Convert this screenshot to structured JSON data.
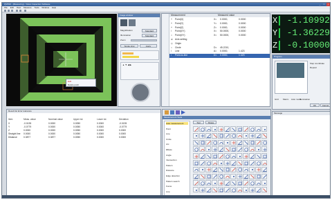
{
  "window": {
    "title": "QVPAK - [Measuring] - Vision Inspection Software"
  },
  "menu": [
    "File",
    "Edit",
    "View",
    "Measure",
    "Tools",
    "Window",
    "Help"
  ],
  "measurements": {
    "header": [
      "Measurement",
      "Measured value",
      "Nominal",
      "Difference"
    ],
    "rows": [
      {
        "icon": "+",
        "name": "Point(X)",
        "axis": "X=",
        "value": "0.0000,",
        "v2": "0.0000"
      },
      {
        "icon": "+",
        "name": "Point(Y)",
        "axis": "Y=",
        "value": "0.0000,",
        "v2": "0.0000"
      },
      {
        "icon": "+",
        "name": "Point(Z)",
        "axis": "Z=",
        "value": "0.0000,",
        "v2": "0.0000"
      },
      {
        "icon": "/",
        "name": "Point(XY)",
        "axis": "X=",
        "value": "50.0000,",
        "v2": "0.0000"
      },
      {
        "icon": "○",
        "name": "Point(XY)",
        "axis": "X=",
        "value": "50.0000,",
        "v2": "0.0000"
      },
      {
        "icon": "∠",
        "name": "Axis setting",
        "axis": "",
        "value": "",
        "v2": ""
      },
      {
        "icon": "◇",
        "name": "Origin",
        "axis": "",
        "value": "",
        "v2": ""
      },
      {
        "icon": "○",
        "name": "Circle",
        "axis": "D=",
        "value": "45.2210,",
        "v2": ""
      },
      {
        "icon": "/",
        "name": "Line",
        "axis": "A=",
        "value": "0.0000,",
        "v2": "1.423"
      },
      {
        "icon": "/",
        "name": "Point-to-line",
        "axis": "D=",
        "value": "0.0000,",
        "v2": "1.423"
      }
    ]
  },
  "dro": [
    {
      "axis": "X",
      "value": "-1.10992"
    },
    {
      "axis": "Y",
      "value": "-1.36229"
    },
    {
      "axis": "Z",
      "value": "-0.10000"
    }
  ],
  "camera_panel": {
    "image_label": "Image window",
    "magnification": "Magnification",
    "mag_value": "Standard",
    "illumination": "Illumination",
    "illum_value": "Standard",
    "zoom": "Zoom",
    "btn_single": "Single shot",
    "btn_apply": "Apply"
  },
  "context_menu": [
    "Edit",
    "Delete point"
  ],
  "table": {
    "title": "Result list   Error tolerance",
    "headers": [
      "Item",
      "Meas. value",
      "Nominal value",
      "Upper tol.",
      "Lower tol.",
      "Deviation"
    ],
    "rows": [
      [
        "X",
        "-0.0135",
        "0.0000",
        "0.0050",
        "0.0000",
        "-0.0135"
      ],
      [
        "Y",
        "-0.0779",
        "0.0000",
        "0.0050",
        "0.0000",
        "-0.0779"
      ],
      [
        "Z",
        "0.0000",
        "0.0000",
        "0.0050",
        "0.0000",
        "0.0000"
      ],
      [
        "Straight line",
        "0.0000",
        "0.0000",
        "0.0050",
        "0.0000",
        "0.0000"
      ],
      [
        "Distance",
        "0.3877",
        "0.3877",
        "0.0050",
        "0.0000",
        "0.0000"
      ]
    ]
  },
  "tools_panel": {
    "title": "Measurement Tools",
    "tabs": [
      "Tool",
      "Shape"
    ],
    "categories": [
      "Auto measurement",
      "Point",
      "Line",
      "Circle",
      "Arc",
      "Ellipse",
      "Angle",
      "Intersection",
      "Pattern",
      "Distance",
      "Edge detection",
      "Pattern search",
      "Focus",
      "Line"
    ]
  },
  "right_panel": {
    "title": "Program",
    "options": [
      "Step coordinate",
      "Repeat",
      "Grid",
      "Macro",
      "Auto mode",
      "Illumination"
    ],
    "button_ok": "OK",
    "button_cancel": "Cancel"
  },
  "message": {
    "title": "Message"
  }
}
